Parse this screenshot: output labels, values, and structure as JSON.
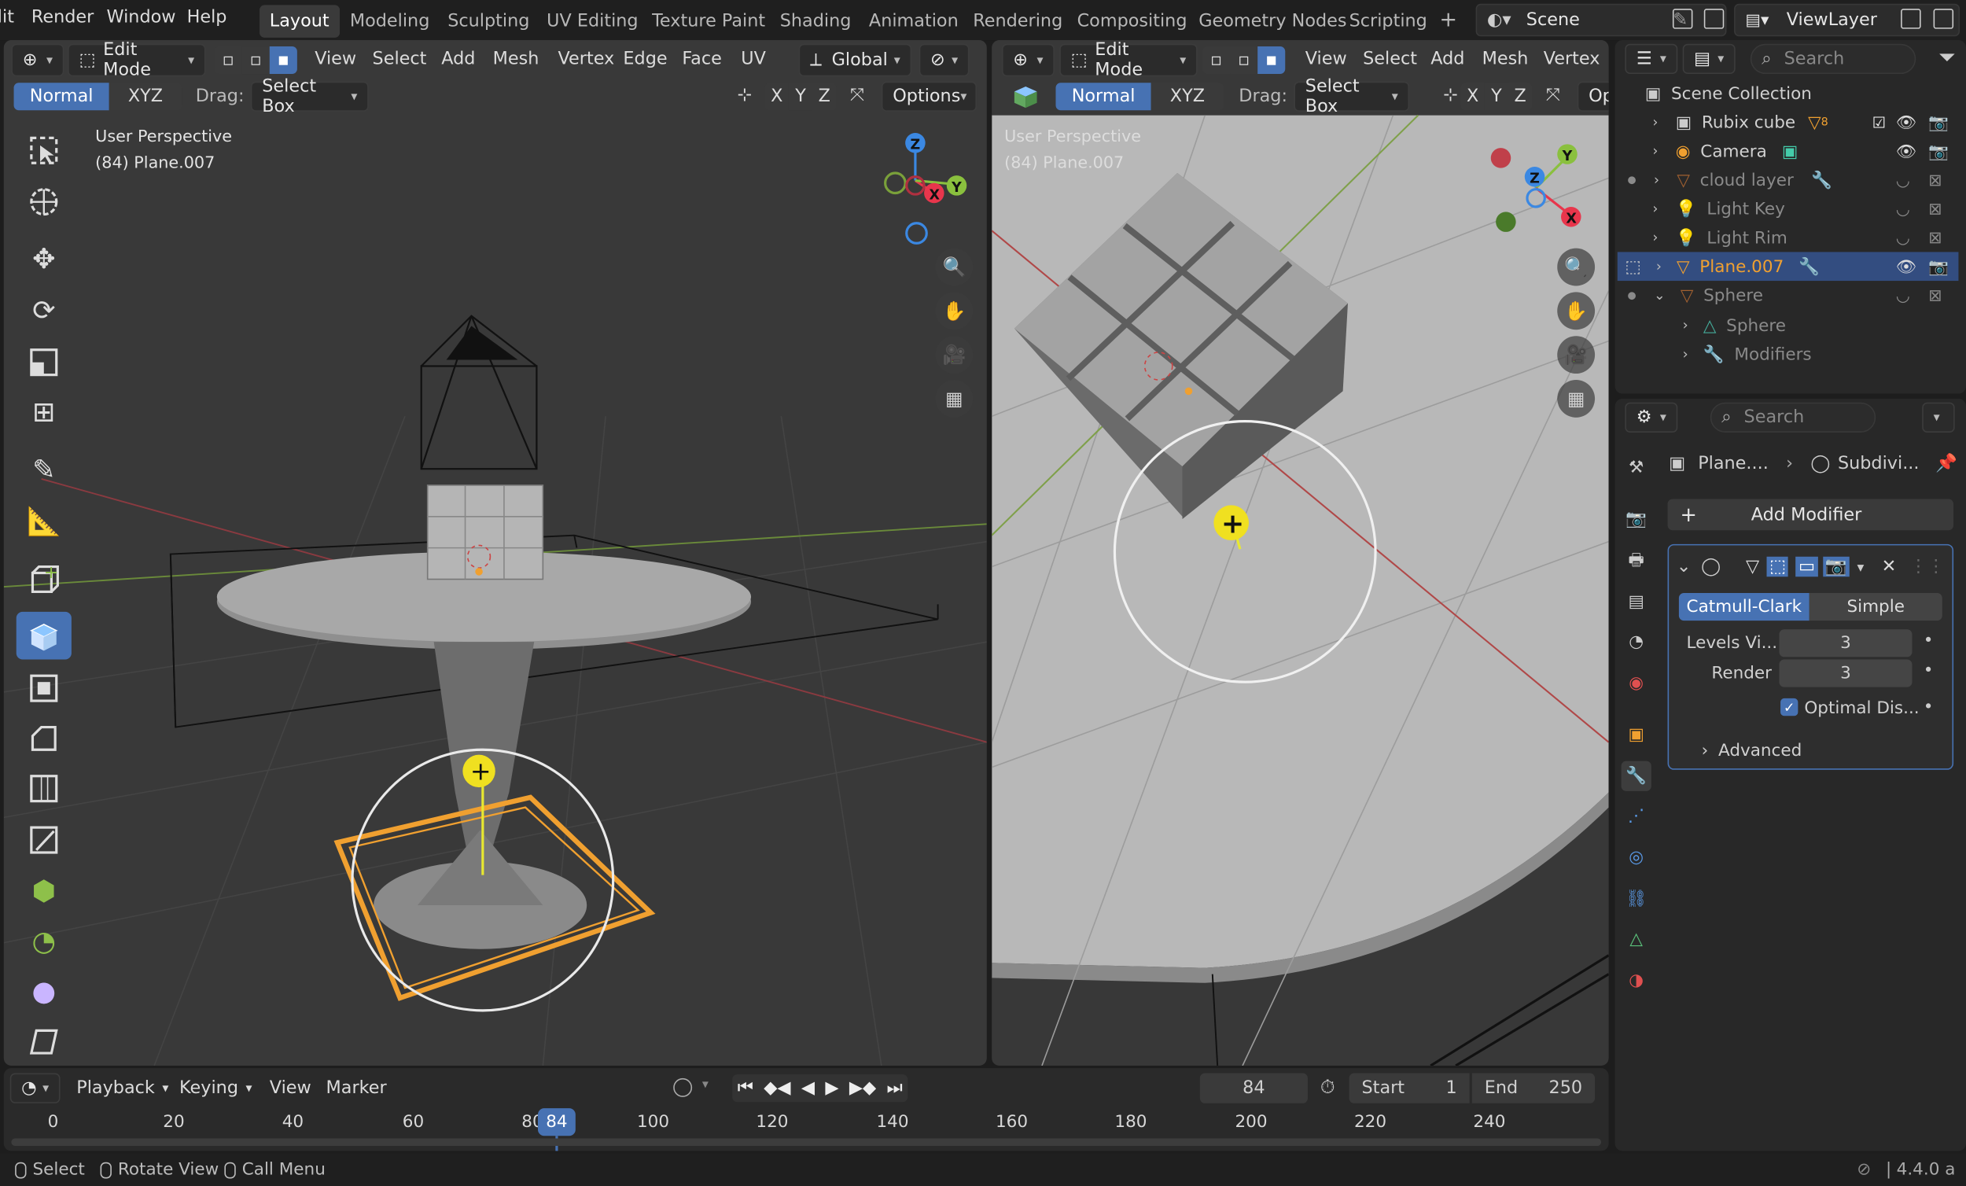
{
  "menu": {
    "items": [
      "lit",
      "Render",
      "Window",
      "Help"
    ]
  },
  "workspaces": [
    "Layout",
    "Modeling",
    "Sculpting",
    "UV Editing",
    "Texture Paint",
    "Shading",
    "Animation",
    "Rendering",
    "Compositing",
    "Geometry Nodes",
    "Scripting"
  ],
  "plus": "+",
  "scene": {
    "name": "Scene",
    "view_layer": "ViewLayer"
  },
  "vp1": {
    "mode": "Edit Mode",
    "menus": [
      "View",
      "Select",
      "Add",
      "Mesh",
      "Vertex",
      "Edge",
      "Face",
      "UV"
    ],
    "orientation": "Global",
    "normal": "Normal",
    "xyz": "XYZ",
    "drag": "Drag:",
    "select_box": "Select Box",
    "axes": [
      "X",
      "Y",
      "Z"
    ],
    "options": "Options",
    "perspective": "User Perspective",
    "object": "(84) Plane.007"
  },
  "vp2": {
    "mode": "Edit Mode",
    "menus": [
      "View",
      "Select",
      "Add",
      "Mesh",
      "Vertex"
    ],
    "normal": "Normal",
    "xyz": "XYZ",
    "drag": "Drag:",
    "select_box": "Select Box",
    "axes": [
      "X",
      "Y",
      "Z"
    ],
    "options_trunc": "Op",
    "perspective": "User Perspective",
    "object": "(84) Plane.007"
  },
  "gizmo": {
    "z": "Z",
    "x": "X",
    "y": "Y"
  },
  "outliner": {
    "search_placeholder": "Search",
    "collection": "Scene Collection",
    "items": [
      "Rubix cube",
      "Camera",
      "cloud layer",
      "Light Key",
      "Light Rim",
      "Plane.007",
      "Sphere",
      "Sphere",
      "Modifiers"
    ],
    "rubix_badge": "8"
  },
  "properties": {
    "search_placeholder": "Search",
    "breadcrumb_object": "Plane....",
    "breadcrumb_mod": "Subdivi...",
    "add_modifier": "Add Modifier",
    "catmull": "Catmull-Clark",
    "simple": "Simple",
    "levels_label": "Levels Vi...",
    "levels_value": "3",
    "render_label": "Render",
    "render_value": "3",
    "optimal": "Optimal Dis...",
    "advanced": "Advanced"
  },
  "timeline": {
    "menus": [
      "Playback",
      "Keying",
      "View",
      "Marker"
    ],
    "current_frame": "84",
    "start_label": "Start",
    "start_value": "1",
    "end_label": "End",
    "end_value": "250",
    "ticks": [
      "0",
      "20",
      "40",
      "60",
      "80",
      "100",
      "120",
      "140",
      "160",
      "180",
      "200",
      "220",
      "240"
    ],
    "playhead": "84"
  },
  "status": {
    "select": "Select",
    "rotate": "Rotate View",
    "call_menu": "Call Menu",
    "version": "4.4.0 a"
  },
  "colors": {
    "accent": "#4772b3",
    "selected_orange": "#f0a030",
    "axis_x": "#e8364c",
    "axis_y": "#8ac03e",
    "axis_z": "#3b88e2"
  }
}
